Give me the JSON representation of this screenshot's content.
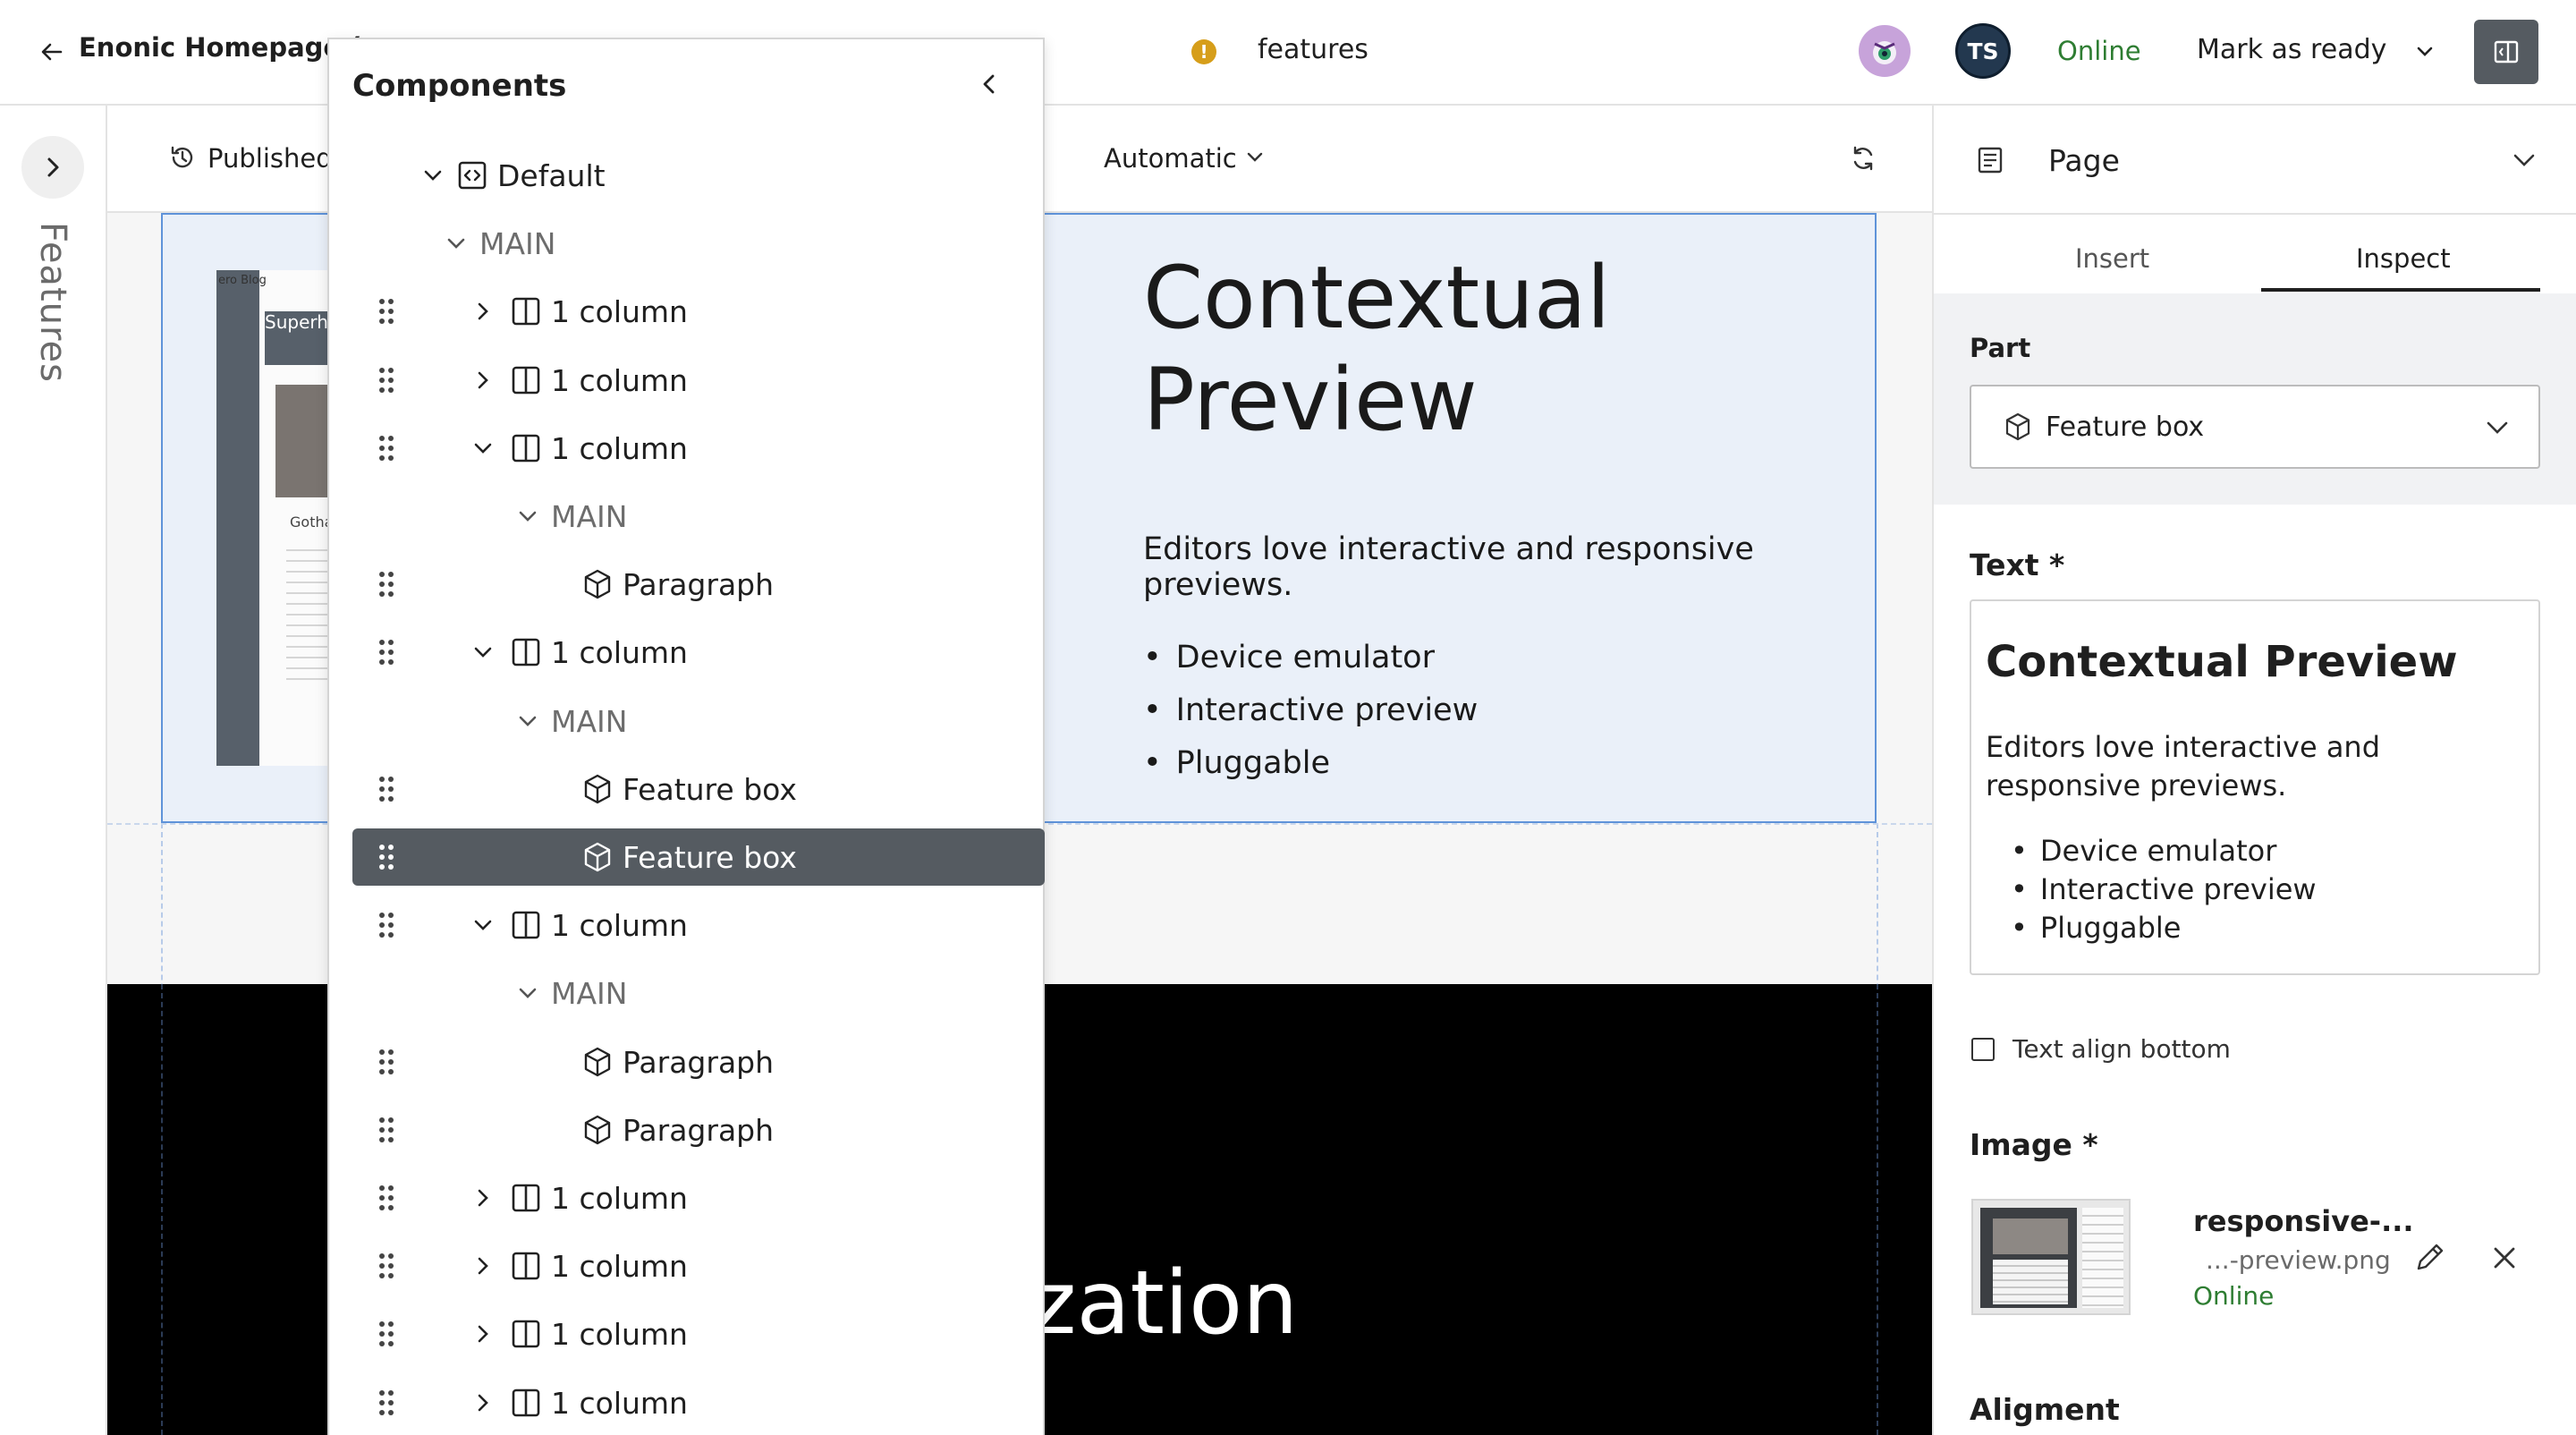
{
  "topbar": {
    "title": "Enonic Homepage (e",
    "content_path": "features",
    "avatar_initials": "TS",
    "status": "Online",
    "mark_ready_label": "Mark as ready"
  },
  "left_rail": {
    "label": "Features"
  },
  "preview_toolbar": {
    "published_label": "Published",
    "mode_label": "Automatic"
  },
  "preview": {
    "feature_title": "Contextual Preview",
    "feature_text": "Editors love interactive and responsive previews.",
    "feature_items": [
      "Device emulator",
      "Interactive preview",
      "Pluggable"
    ],
    "thumb_lines": [
      "ero Blog",
      "Superhe",
      "Gotha"
    ],
    "black_section_title": "zation"
  },
  "components_panel": {
    "title": "Components",
    "tree": [
      {
        "label": "Default",
        "kind": "page",
        "expanded": true
      },
      {
        "label": "MAIN",
        "kind": "region",
        "expanded": true
      },
      {
        "label": "1 column",
        "kind": "layout",
        "expanded": false
      },
      {
        "label": "1 column",
        "kind": "layout",
        "expanded": false
      },
      {
        "label": "1 column",
        "kind": "layout",
        "expanded": true
      },
      {
        "label": "MAIN",
        "kind": "region",
        "expanded": true
      },
      {
        "label": "Paragraph",
        "kind": "part"
      },
      {
        "label": "1 column",
        "kind": "layout",
        "expanded": true
      },
      {
        "label": "MAIN",
        "kind": "region",
        "expanded": true
      },
      {
        "label": "Feature box",
        "kind": "part"
      },
      {
        "label": "Feature box",
        "kind": "part",
        "selected": true
      },
      {
        "label": "1 column",
        "kind": "layout",
        "expanded": true
      },
      {
        "label": "MAIN",
        "kind": "region",
        "expanded": true
      },
      {
        "label": "Paragraph",
        "kind": "part"
      },
      {
        "label": "Paragraph",
        "kind": "part"
      },
      {
        "label": "1 column",
        "kind": "layout",
        "expanded": false
      },
      {
        "label": "1 column",
        "kind": "layout",
        "expanded": false
      },
      {
        "label": "1 column",
        "kind": "layout",
        "expanded": false
      },
      {
        "label": "1 column",
        "kind": "layout",
        "expanded": false
      }
    ]
  },
  "right_panel": {
    "title": "Page",
    "tabs": [
      "Insert",
      "Inspect"
    ],
    "active_tab": "Inspect",
    "part_label": "Part",
    "part_value": "Feature box",
    "text_label": "Text *",
    "editor": {
      "heading": "Contextual Preview",
      "paragraph": "Editors love interactive and responsive previews.",
      "items": [
        "Device emulator",
        "Interactive preview",
        "Pluggable"
      ]
    },
    "checkbox_label": "Text align bottom",
    "checkbox_checked": false,
    "image_label": "Image *",
    "image_name": "responsive-...",
    "image_path": "...-preview.png",
    "image_status": "Online",
    "alignment_label": "Aligment"
  },
  "colors": {
    "status_green": "#2e7d32",
    "warning": "#d69e1a",
    "selected_row": "#555b61",
    "feature_bg": "#eaf0f9",
    "feature_border": "#5f93d9"
  }
}
